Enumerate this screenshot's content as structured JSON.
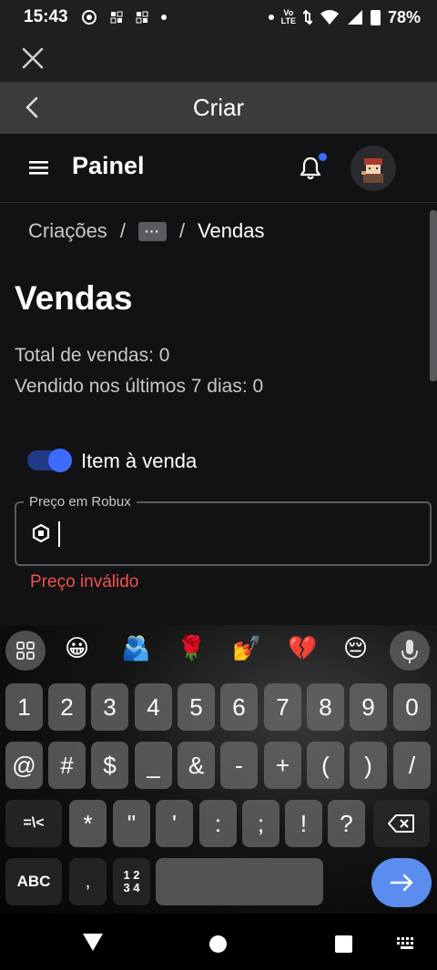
{
  "status_bar": {
    "time": "15:43",
    "lte_top": "Vo",
    "lte_bottom": "LTE",
    "battery": "78%"
  },
  "top_bar": {
    "title": "Criar"
  },
  "app_header": {
    "title": "Painel"
  },
  "breadcrumb": {
    "items": [
      "Criações",
      "Vendas"
    ],
    "separator": "/",
    "more_label": "···"
  },
  "page": {
    "title": "Vendas",
    "total_sales": "Total de vendas: 0",
    "sold_last_7": "Vendido nos últimos 7 dias: 0"
  },
  "toggle": {
    "label": "Item à venda",
    "on": true
  },
  "price_field": {
    "label": "Preço em Robux",
    "value": "",
    "error": "Preço inválido"
  },
  "keyboard": {
    "emojis": [
      "😀",
      "🫂",
      "🌹",
      "💅",
      "💔",
      "😔"
    ],
    "row1": [
      "1",
      "2",
      "3",
      "4",
      "5",
      "6",
      "7",
      "8",
      "9",
      "0"
    ],
    "row2": [
      "@",
      "#",
      "$",
      "_",
      "&",
      "-",
      "+",
      "(",
      ")",
      "/"
    ],
    "row3": [
      "=\\<",
      "*",
      "\"",
      "'",
      ":",
      ";",
      "!",
      "?"
    ],
    "abc_label": "ABC",
    "comma_label": ",",
    "numpad_label": "1 2\n3 4"
  },
  "colors": {
    "accent": "#3b6cff",
    "error": "#f2534a",
    "enter_key": "#5b8def"
  }
}
